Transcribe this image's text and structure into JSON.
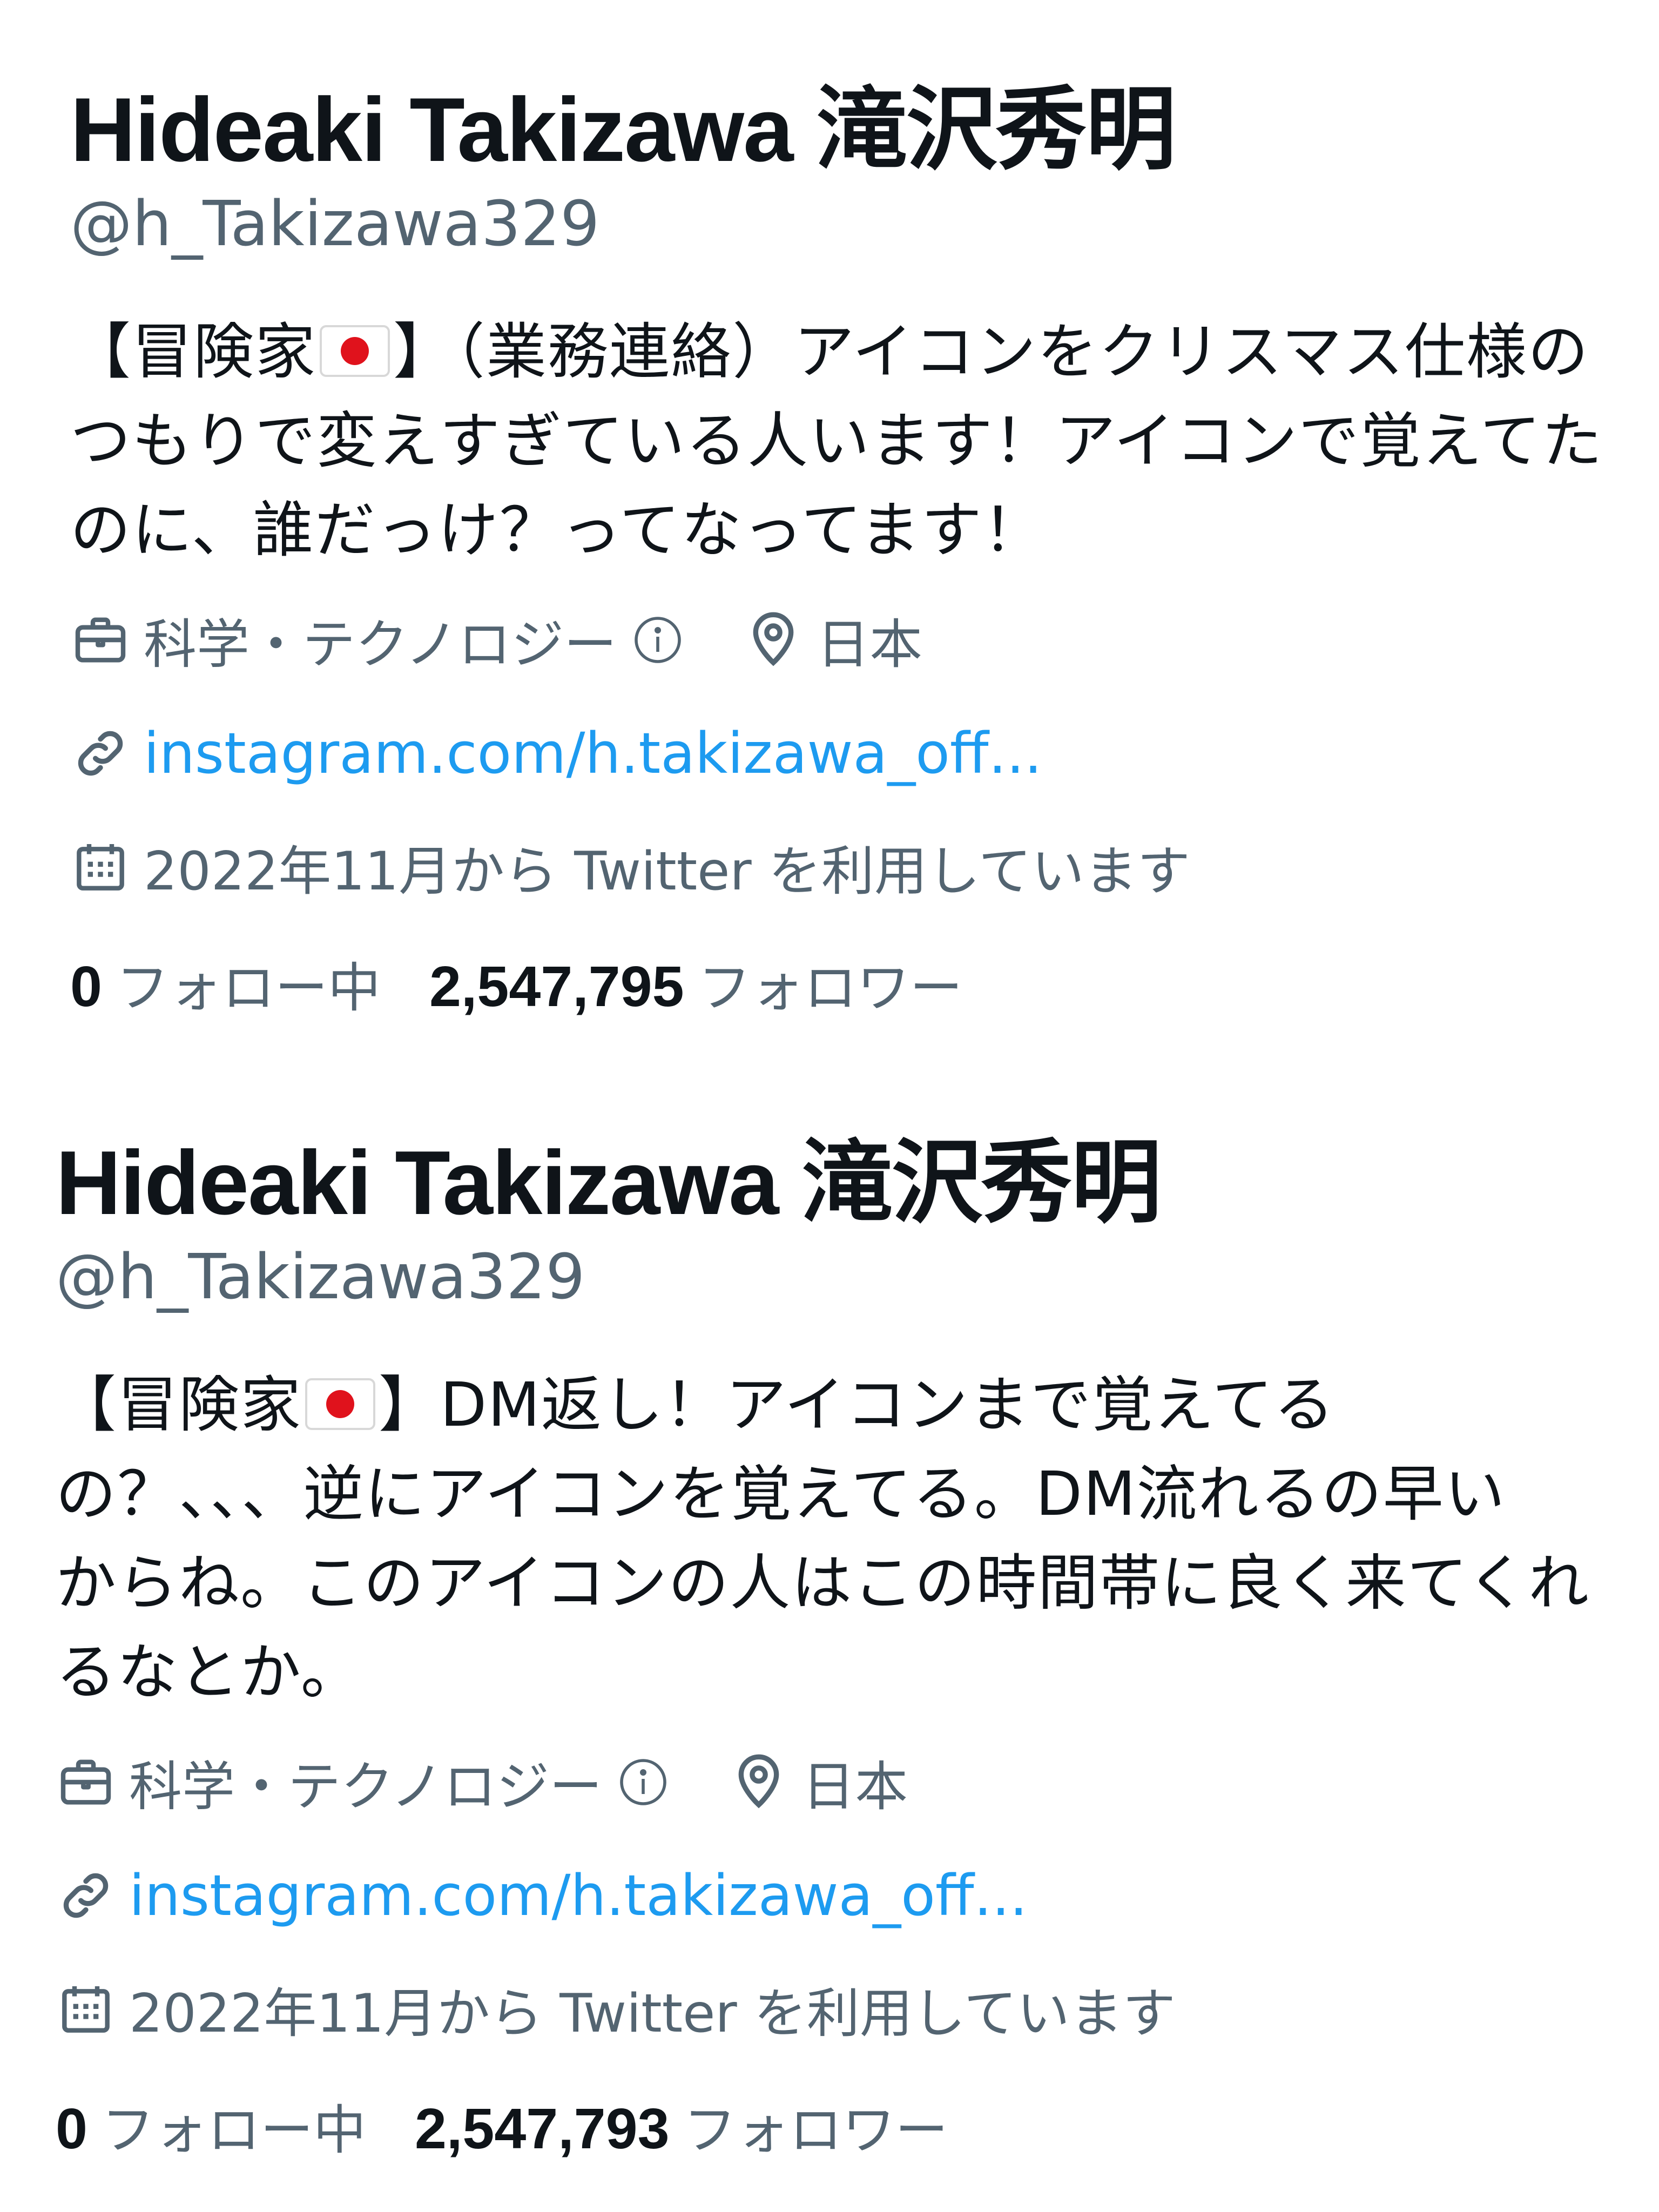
{
  "profiles": [
    {
      "name": "Hideaki Takizawa 滝沢秀明",
      "handle": "@h_Takizawa329",
      "bio_prefix": "【冒険家",
      "bio_flag_icon": "japan-flag-emoji",
      "bio_text": "】（業務連絡）アイコンをクリスマス仕様の\nつもりで変えすぎている人います！アイコンで覚えてた\nのに、誰だっけ？ってなってます！",
      "category": "科学・テクノロジー",
      "location": "日本",
      "link": "instagram.com/h.takizawa_off...",
      "joined": "2022年11月から Twitter を利用しています",
      "following_count": "0",
      "following_label": "フォロー中",
      "followers_count": "2,547,795",
      "followers_label": "フォロワー"
    },
    {
      "name": "Hideaki Takizawa 滝沢秀明",
      "handle": "@h_Takizawa329",
      "bio_prefix": "【冒険家",
      "bio_flag_icon": "japan-flag-emoji",
      "bio_text": "】DM返し！アイコンまで覚えてる\nの？、、、逆にアイコンを覚えてる。DM流れるの早い\nからね。このアイコンの人はこの時間帯に良く来てくれ\nるなとか。",
      "category": "科学・テクノロジー",
      "location": "日本",
      "link": "instagram.com/h.takizawa_off...",
      "joined": "2022年11月から Twitter を利用しています",
      "following_count": "0",
      "following_label": "フォロー中",
      "followers_count": "2,547,793",
      "followers_label": "フォロワー"
    }
  ],
  "colors": {
    "text_primary": "#0f1419",
    "text_secondary": "#536471",
    "link": "#1d9bf0",
    "background": "#ffffff"
  },
  "icons": {
    "category": "briefcase-icon",
    "info": "info-icon",
    "location": "location-pin-icon",
    "link": "link-icon",
    "joined": "calendar-icon"
  }
}
